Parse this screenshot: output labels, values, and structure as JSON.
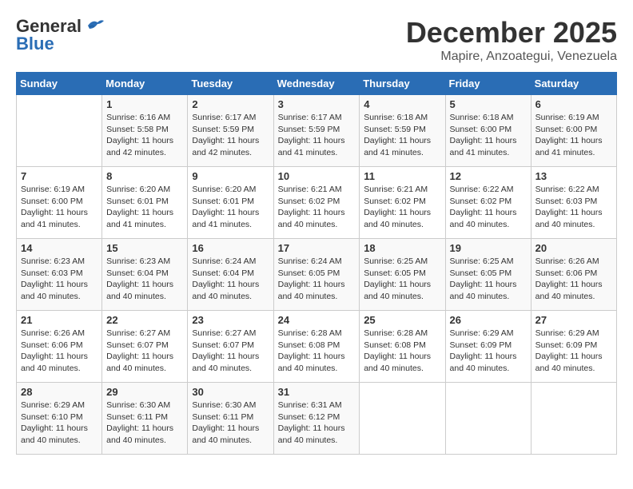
{
  "logo": {
    "general": "General",
    "blue": "Blue"
  },
  "title": "December 2025",
  "location": "Mapire, Anzoategui, Venezuela",
  "weekdays": [
    "Sunday",
    "Monday",
    "Tuesday",
    "Wednesday",
    "Thursday",
    "Friday",
    "Saturday"
  ],
  "weeks": [
    [
      {
        "day": "",
        "sunrise": "",
        "sunset": "",
        "daylight": ""
      },
      {
        "day": "1",
        "sunrise": "Sunrise: 6:16 AM",
        "sunset": "Sunset: 5:58 PM",
        "daylight": "Daylight: 11 hours and 42 minutes."
      },
      {
        "day": "2",
        "sunrise": "Sunrise: 6:17 AM",
        "sunset": "Sunset: 5:59 PM",
        "daylight": "Daylight: 11 hours and 42 minutes."
      },
      {
        "day": "3",
        "sunrise": "Sunrise: 6:17 AM",
        "sunset": "Sunset: 5:59 PM",
        "daylight": "Daylight: 11 hours and 41 minutes."
      },
      {
        "day": "4",
        "sunrise": "Sunrise: 6:18 AM",
        "sunset": "Sunset: 5:59 PM",
        "daylight": "Daylight: 11 hours and 41 minutes."
      },
      {
        "day": "5",
        "sunrise": "Sunrise: 6:18 AM",
        "sunset": "Sunset: 6:00 PM",
        "daylight": "Daylight: 11 hours and 41 minutes."
      },
      {
        "day": "6",
        "sunrise": "Sunrise: 6:19 AM",
        "sunset": "Sunset: 6:00 PM",
        "daylight": "Daylight: 11 hours and 41 minutes."
      }
    ],
    [
      {
        "day": "7",
        "sunrise": "Sunrise: 6:19 AM",
        "sunset": "Sunset: 6:00 PM",
        "daylight": "Daylight: 11 hours and 41 minutes."
      },
      {
        "day": "8",
        "sunrise": "Sunrise: 6:20 AM",
        "sunset": "Sunset: 6:01 PM",
        "daylight": "Daylight: 11 hours and 41 minutes."
      },
      {
        "day": "9",
        "sunrise": "Sunrise: 6:20 AM",
        "sunset": "Sunset: 6:01 PM",
        "daylight": "Daylight: 11 hours and 41 minutes."
      },
      {
        "day": "10",
        "sunrise": "Sunrise: 6:21 AM",
        "sunset": "Sunset: 6:02 PM",
        "daylight": "Daylight: 11 hours and 40 minutes."
      },
      {
        "day": "11",
        "sunrise": "Sunrise: 6:21 AM",
        "sunset": "Sunset: 6:02 PM",
        "daylight": "Daylight: 11 hours and 40 minutes."
      },
      {
        "day": "12",
        "sunrise": "Sunrise: 6:22 AM",
        "sunset": "Sunset: 6:02 PM",
        "daylight": "Daylight: 11 hours and 40 minutes."
      },
      {
        "day": "13",
        "sunrise": "Sunrise: 6:22 AM",
        "sunset": "Sunset: 6:03 PM",
        "daylight": "Daylight: 11 hours and 40 minutes."
      }
    ],
    [
      {
        "day": "14",
        "sunrise": "Sunrise: 6:23 AM",
        "sunset": "Sunset: 6:03 PM",
        "daylight": "Daylight: 11 hours and 40 minutes."
      },
      {
        "day": "15",
        "sunrise": "Sunrise: 6:23 AM",
        "sunset": "Sunset: 6:04 PM",
        "daylight": "Daylight: 11 hours and 40 minutes."
      },
      {
        "day": "16",
        "sunrise": "Sunrise: 6:24 AM",
        "sunset": "Sunset: 6:04 PM",
        "daylight": "Daylight: 11 hours and 40 minutes."
      },
      {
        "day": "17",
        "sunrise": "Sunrise: 6:24 AM",
        "sunset": "Sunset: 6:05 PM",
        "daylight": "Daylight: 11 hours and 40 minutes."
      },
      {
        "day": "18",
        "sunrise": "Sunrise: 6:25 AM",
        "sunset": "Sunset: 6:05 PM",
        "daylight": "Daylight: 11 hours and 40 minutes."
      },
      {
        "day": "19",
        "sunrise": "Sunrise: 6:25 AM",
        "sunset": "Sunset: 6:05 PM",
        "daylight": "Daylight: 11 hours and 40 minutes."
      },
      {
        "day": "20",
        "sunrise": "Sunrise: 6:26 AM",
        "sunset": "Sunset: 6:06 PM",
        "daylight": "Daylight: 11 hours and 40 minutes."
      }
    ],
    [
      {
        "day": "21",
        "sunrise": "Sunrise: 6:26 AM",
        "sunset": "Sunset: 6:06 PM",
        "daylight": "Daylight: 11 hours and 40 minutes."
      },
      {
        "day": "22",
        "sunrise": "Sunrise: 6:27 AM",
        "sunset": "Sunset: 6:07 PM",
        "daylight": "Daylight: 11 hours and 40 minutes."
      },
      {
        "day": "23",
        "sunrise": "Sunrise: 6:27 AM",
        "sunset": "Sunset: 6:07 PM",
        "daylight": "Daylight: 11 hours and 40 minutes."
      },
      {
        "day": "24",
        "sunrise": "Sunrise: 6:28 AM",
        "sunset": "Sunset: 6:08 PM",
        "daylight": "Daylight: 11 hours and 40 minutes."
      },
      {
        "day": "25",
        "sunrise": "Sunrise: 6:28 AM",
        "sunset": "Sunset: 6:08 PM",
        "daylight": "Daylight: 11 hours and 40 minutes."
      },
      {
        "day": "26",
        "sunrise": "Sunrise: 6:29 AM",
        "sunset": "Sunset: 6:09 PM",
        "daylight": "Daylight: 11 hours and 40 minutes."
      },
      {
        "day": "27",
        "sunrise": "Sunrise: 6:29 AM",
        "sunset": "Sunset: 6:09 PM",
        "daylight": "Daylight: 11 hours and 40 minutes."
      }
    ],
    [
      {
        "day": "28",
        "sunrise": "Sunrise: 6:29 AM",
        "sunset": "Sunset: 6:10 PM",
        "daylight": "Daylight: 11 hours and 40 minutes."
      },
      {
        "day": "29",
        "sunrise": "Sunrise: 6:30 AM",
        "sunset": "Sunset: 6:11 PM",
        "daylight": "Daylight: 11 hours and 40 minutes."
      },
      {
        "day": "30",
        "sunrise": "Sunrise: 6:30 AM",
        "sunset": "Sunset: 6:11 PM",
        "daylight": "Daylight: 11 hours and 40 minutes."
      },
      {
        "day": "31",
        "sunrise": "Sunrise: 6:31 AM",
        "sunset": "Sunset: 6:12 PM",
        "daylight": "Daylight: 11 hours and 40 minutes."
      },
      {
        "day": "",
        "sunrise": "",
        "sunset": "",
        "daylight": ""
      },
      {
        "day": "",
        "sunrise": "",
        "sunset": "",
        "daylight": ""
      },
      {
        "day": "",
        "sunrise": "",
        "sunset": "",
        "daylight": ""
      }
    ]
  ]
}
